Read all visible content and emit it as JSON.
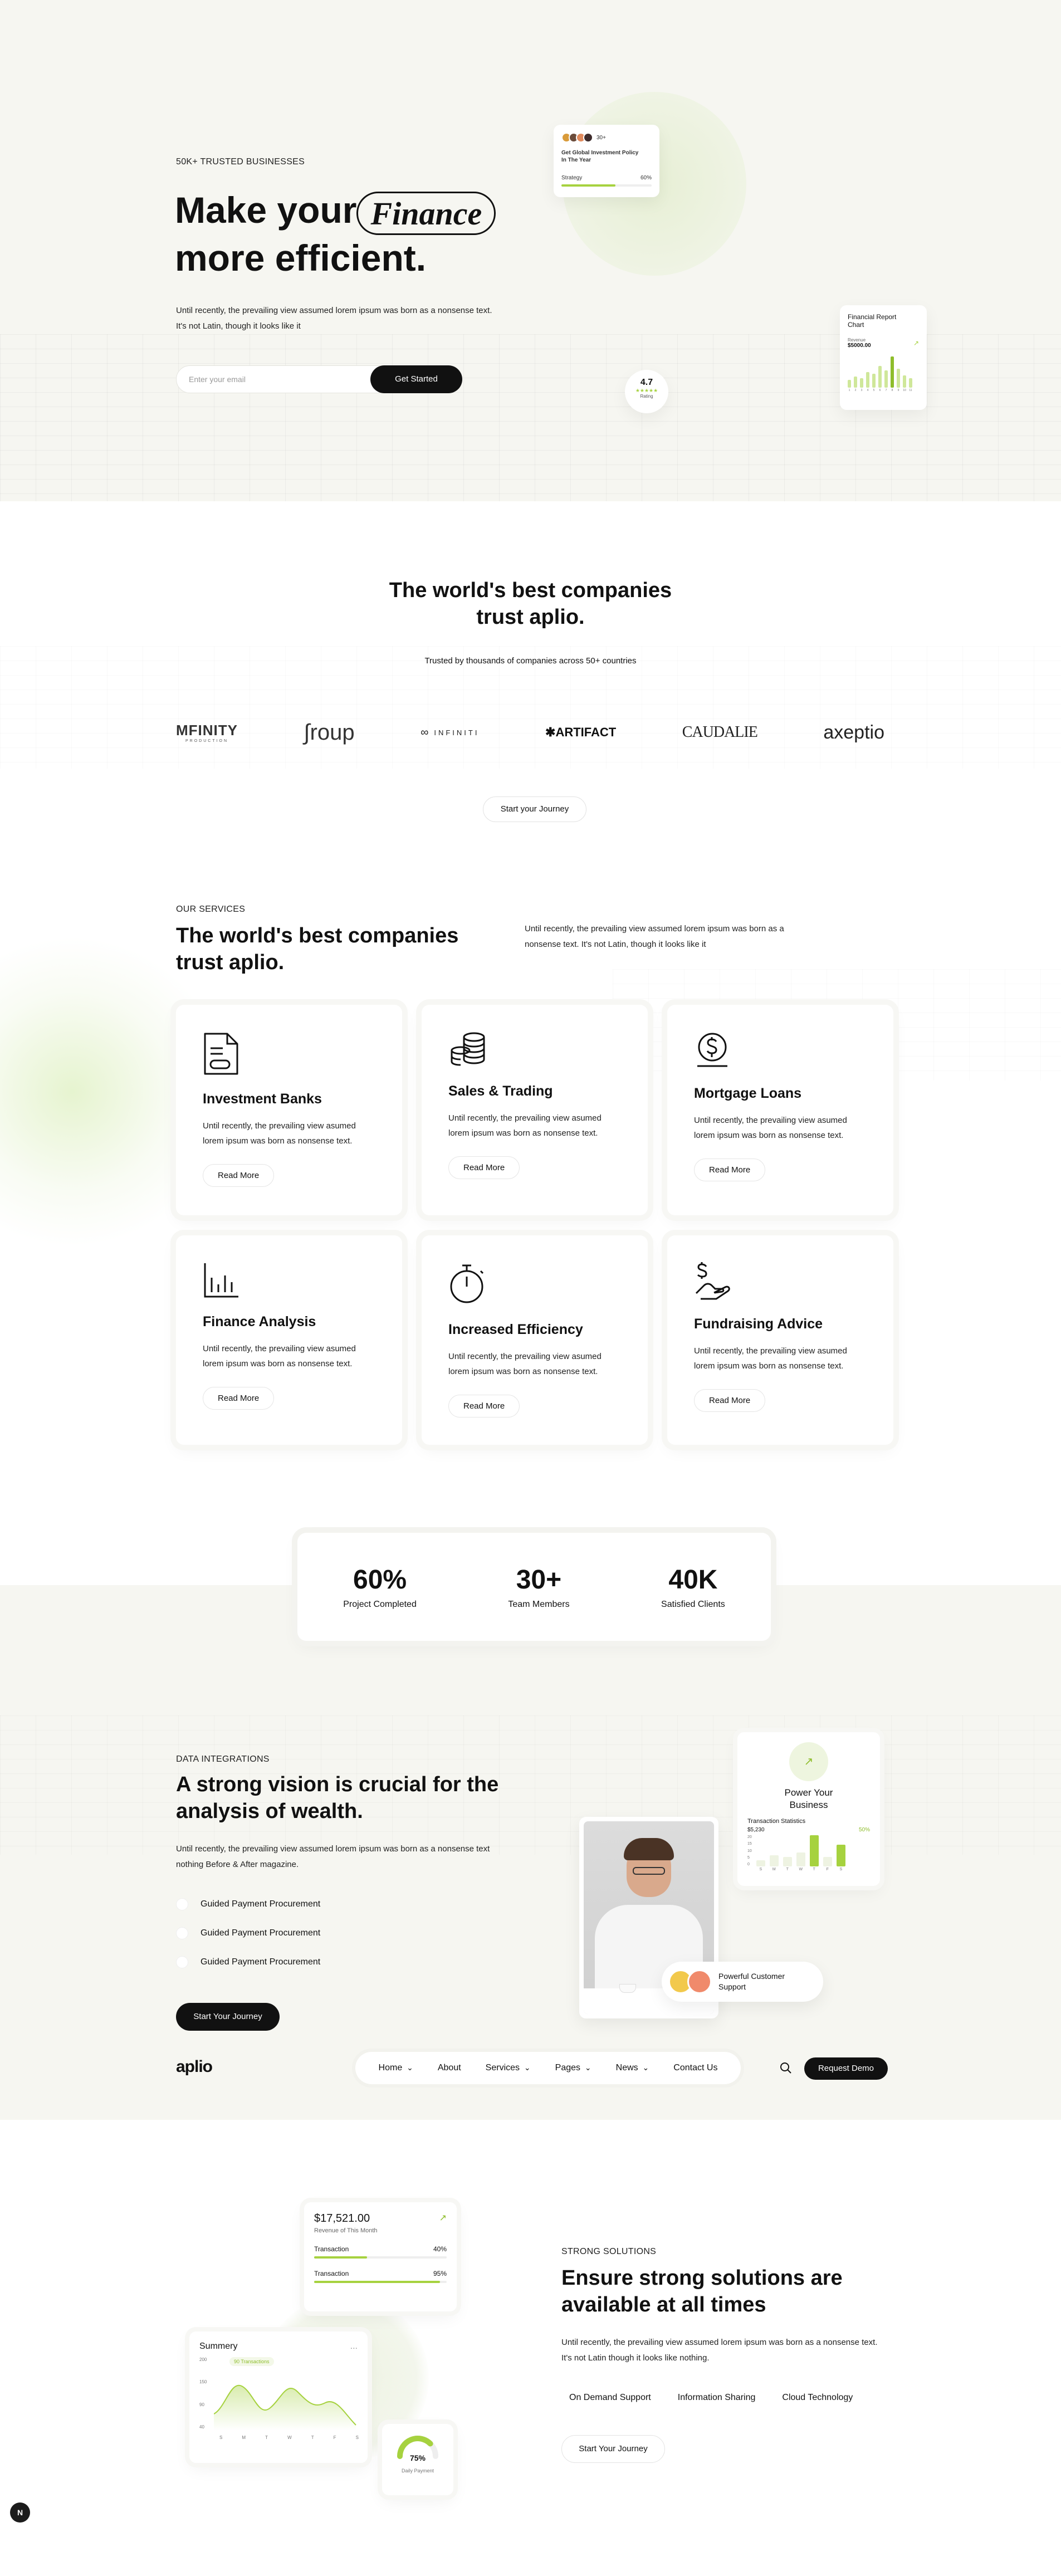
{
  "hero": {
    "eyebrow": "50K+ TRUSTED BUSINESSES",
    "title_pre": "Make your",
    "title_word": "Finance",
    "title_post": "more efficient.",
    "desc_line1": "Until recently, the prevailing view assumed lorem ipsum was born as a nonsense text.",
    "desc_line2": "It's not Latin, though it looks like it",
    "email_placeholder": "Enter your email",
    "cta": "Get Started",
    "policy_card": {
      "avatar_count": "30+",
      "title_line1": "Get Global Investment Policy",
      "title_line2": "In The Year",
      "label": "Strategy",
      "percent": "60%",
      "progress": 0.6
    },
    "rating": {
      "value": "4.7",
      "stars": "★★★★★",
      "label": "Rating"
    },
    "report_card": {
      "title_line1": "Financial Report",
      "title_line2": "Chart",
      "label": "Revenue",
      "amount": "$5000.00",
      "bars": [
        0.25,
        0.35,
        0.3,
        0.5,
        0.45,
        0.7,
        0.55,
        1.0,
        0.6,
        0.4,
        0.3
      ],
      "x_labels": [
        "1",
        "2",
        "3",
        "4",
        "5",
        "6",
        "7",
        "8",
        "9",
        "10",
        "11"
      ]
    }
  },
  "trust": {
    "title_line1": "The world's best companies",
    "title_line2": "trust aplio.",
    "subtitle": "Trusted by thousands of companies across 50+ countries",
    "logos": [
      "MFINITY",
      "roup",
      "INFINITI",
      "ARTIFACT",
      "CAUDALIE",
      "axeptio"
    ],
    "logo_sub": "PRODUCTION",
    "cta": "Start your Journey"
  },
  "services": {
    "eyebrow": "OUR SERVICES",
    "title_line1": "The world's best companies",
    "title_line2": "trust aplio.",
    "desc_line1": "Until recently, the prevailing view assumed lorem ipsum was born as a",
    "desc_line2": "nonsense text. It's not Latin, though it looks like it",
    "items": [
      {
        "title": "Investment Banks",
        "icon": "document-icon",
        "line1": "Until recently, the prevailing view asumed",
        "line2": "lorem ipsum was born as nonsense text.",
        "cta": "Read More"
      },
      {
        "title": "Sales & Trading",
        "icon": "coins-icon",
        "line1": "Until recently, the prevailing view asumed",
        "line2": "lorem ipsum was born as nonsense text.",
        "cta": "Read More"
      },
      {
        "title": "Mortgage Loans",
        "icon": "dollar-hand-icon",
        "line1": "Until recently, the prevailing view asumed",
        "line2": "lorem ipsum was born as nonsense text.",
        "cta": "Read More"
      },
      {
        "title": "Finance Analysis",
        "icon": "bar-chart-icon",
        "line1": "Until recently, the prevailing view asumed",
        "line2": "lorem ipsum was born as nonsense text.",
        "cta": "Read More"
      },
      {
        "title": "Increased Efficiency",
        "icon": "stopwatch-icon",
        "line1": "Until recently, the prevailing view asumed",
        "line2": "lorem ipsum was born as nonsense text.",
        "cta": "Read More"
      },
      {
        "title": "Fundraising Advice",
        "icon": "money-hand-icon",
        "line1": "Until recently, the prevailing view asumed",
        "line2": "lorem ipsum was born as nonsense text.",
        "cta": "Read More"
      }
    ]
  },
  "stats": [
    {
      "value": "60%",
      "label": "Project Completed"
    },
    {
      "value": "30+",
      "label": "Team Members"
    },
    {
      "value": "40K",
      "label": "Satisfied Clients"
    }
  ],
  "integrations": {
    "eyebrow": "DATA INTEGRATIONS",
    "title_line1": "A strong vision is crucial for the",
    "title_line2": "analysis of wealth.",
    "desc_line1": "Until recently, the prevailing view assumed lorem ipsum was born as a nonsense text",
    "desc_line2": "nothing Before & After magazine.",
    "bullets": [
      "Guided Payment Procurement",
      "Guided Payment Procurement",
      "Guided Payment Procurement"
    ],
    "cta": "Start Your Journey",
    "power_card": {
      "title_line1": "Power Your",
      "title_line2": "Business",
      "stats_title": "Transaction Statistics",
      "amount": "$5,230",
      "percent": "50%",
      "y_labels": [
        "20",
        "15",
        "10",
        "5",
        "0"
      ],
      "x_labels": [
        "S",
        "M",
        "T",
        "W",
        "T",
        "F",
        "S"
      ],
      "bars": [
        0.2,
        0.35,
        0.3,
        0.45,
        1.0,
        0.3,
        0.7
      ]
    },
    "support_line1": "Powerful Customer",
    "support_line2": "Support"
  },
  "navbar": {
    "logo": "aplio",
    "items": [
      "Home",
      "About",
      "Services",
      "Pages",
      "News",
      "Contact Us"
    ],
    "has_chevron": [
      true,
      false,
      true,
      true,
      true,
      false
    ],
    "cta": "Request Demo"
  },
  "solutions": {
    "eyebrow": "STRONG SOLUTIONS",
    "title_line1": "Ensure strong solutions are",
    "title_line2": "available at all times",
    "desc_line1": "Until recently, the prevailing view assumed lorem ipsum was born as a nonsense text.",
    "desc_line2": "It's not Latin though it looks like nothing.",
    "tags": [
      "On Demand Support",
      "Information Sharing",
      "Cloud Technology"
    ],
    "cta": "Start Your Journey",
    "revenue_card": {
      "amount": "$17,521.00",
      "label": "Revenue of This Month",
      "rows": [
        {
          "name": "Transaction",
          "percent": "40%",
          "value": 0.4
        },
        {
          "name": "Transaction",
          "percent": "95%",
          "value": 0.95
        }
      ]
    },
    "summary_card": {
      "title": "Summery",
      "menu": "...",
      "badge": "90 Transactions",
      "y_labels": [
        "200",
        "150",
        "90",
        "40"
      ],
      "x_labels": [
        "S",
        "M",
        "T",
        "W",
        "T",
        "F",
        "S"
      ]
    },
    "daily_card": {
      "percent": "75%",
      "label": "Daily Payment",
      "value": 0.75
    }
  },
  "floating_button": "N"
}
